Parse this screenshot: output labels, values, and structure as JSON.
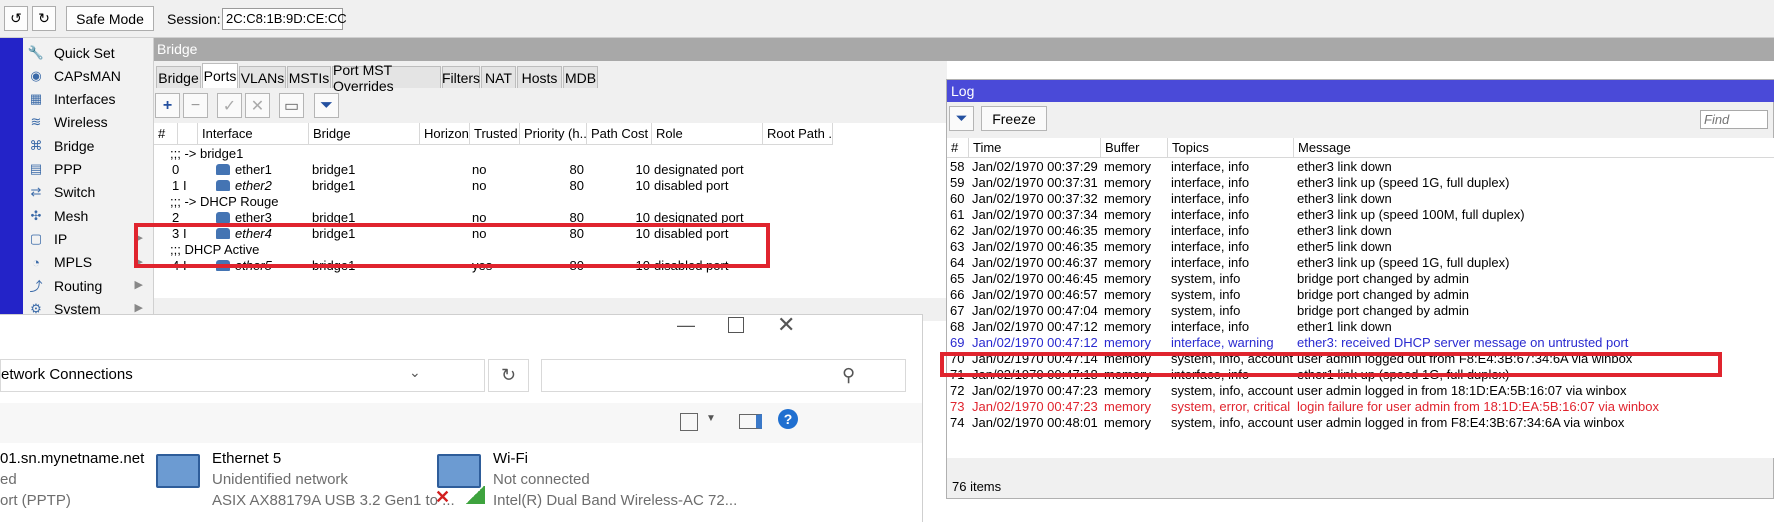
{
  "toolbar": {
    "undo_icon": "↺",
    "redo_icon": "↻",
    "safe_mode_label": "Safe Mode",
    "session_label": "Session:",
    "session_value": "2C:C8:1B:9D:CE:CC"
  },
  "menu": {
    "items": [
      {
        "label": "Quick Set",
        "icon": "wrench-icon"
      },
      {
        "label": "CAPsMAN",
        "icon": "capsman-icon"
      },
      {
        "label": "Interfaces",
        "icon": "interfaces-icon"
      },
      {
        "label": "Wireless",
        "icon": "wireless-icon"
      },
      {
        "label": "Bridge",
        "icon": "bridge-icon"
      },
      {
        "label": "PPP",
        "icon": "ppp-icon"
      },
      {
        "label": "Switch",
        "icon": "switch-icon"
      },
      {
        "label": "Mesh",
        "icon": "mesh-icon"
      },
      {
        "label": "IP",
        "icon": "ip-icon",
        "has_submenu": true
      },
      {
        "label": "MPLS",
        "icon": "mpls-icon",
        "has_submenu": true
      },
      {
        "label": "Routing",
        "icon": "routing-icon",
        "has_submenu": true
      },
      {
        "label": "System",
        "icon": "system-icon",
        "has_submenu": true
      }
    ]
  },
  "bridge": {
    "title": "Bridge",
    "tabs": [
      "Bridge",
      "Ports",
      "VLANs",
      "MSTIs",
      "Port MST Overrides",
      "Filters",
      "NAT",
      "Hosts",
      "MDB"
    ],
    "active_tab": "Ports",
    "actions": {
      "add": "+",
      "remove": "−",
      "enable": "✓",
      "disable": "✕",
      "comment": "▭",
      "filter": "⏷"
    },
    "columns": [
      "#",
      "Interface",
      "Bridge",
      "Horizon",
      "Trusted",
      "Priority (h...",
      "Path Cost",
      "Role",
      "Root Path ..."
    ],
    "rows": [
      {
        "type": "group",
        "text": ";;; -> bridge1"
      },
      {
        "type": "port",
        "num": "0",
        "flag": "",
        "iface": "ether1",
        "bridge": "bridge1",
        "trusted": "no",
        "priority": "80",
        "cost": "10",
        "role": "designated port",
        "italic": false
      },
      {
        "type": "port",
        "num": "1",
        "flag": "I",
        "iface": "ether2",
        "bridge": "bridge1",
        "trusted": "no",
        "priority": "80",
        "cost": "10",
        "role": "disabled port",
        "italic": true
      },
      {
        "type": "group",
        "text": ";;; -> DHCP Rouge"
      },
      {
        "type": "port",
        "num": "2",
        "flag": "",
        "iface": "ether3",
        "bridge": "bridge1",
        "trusted": "no",
        "priority": "80",
        "cost": "10",
        "role": "designated port",
        "italic": false
      },
      {
        "type": "port",
        "num": "3",
        "flag": "I",
        "iface": "ether4",
        "bridge": "bridge1",
        "trusted": "no",
        "priority": "80",
        "cost": "10",
        "role": "disabled port",
        "italic": true
      },
      {
        "type": "group",
        "text": ";;; DHCP Active"
      },
      {
        "type": "port",
        "num": "4",
        "flag": "I",
        "iface": "ether5",
        "bridge": "bridge1",
        "trusted": "yes",
        "priority": "80",
        "cost": "10",
        "role": "disabled port",
        "italic": true
      }
    ]
  },
  "netconn": {
    "address": "etwork Connections",
    "refresh_icon": "↻",
    "search_icon": "⚲",
    "help_icon": "?",
    "items": [
      {
        "name": "01.sn.mynetname.net",
        "status": "ed",
        "device": "ort (PPTP)"
      },
      {
        "name": "Ethernet 5",
        "status": "Unidentified network",
        "device": "ASIX AX88179A USB 3.2 Gen1 to ..."
      },
      {
        "name": "Wi-Fi",
        "status": "Not connected",
        "device": "Intel(R) Dual Band Wireless-AC 72..."
      }
    ]
  },
  "log": {
    "title": "Log",
    "freeze_label": "Freeze",
    "find_placeholder": "Find",
    "columns": [
      "#",
      "Time",
      "Buffer",
      "Topics",
      "Message"
    ],
    "rows": [
      {
        "num": "58",
        "time": "Jan/02/1970 00:37:29",
        "buffer": "memory",
        "topics": "interface, info",
        "message": "ether3 link down",
        "level": "info"
      },
      {
        "num": "59",
        "time": "Jan/02/1970 00:37:31",
        "buffer": "memory",
        "topics": "interface, info",
        "message": "ether3 link up (speed 1G, full duplex)",
        "level": "info"
      },
      {
        "num": "60",
        "time": "Jan/02/1970 00:37:32",
        "buffer": "memory",
        "topics": "interface, info",
        "message": "ether3 link down",
        "level": "info"
      },
      {
        "num": "61",
        "time": "Jan/02/1970 00:37:34",
        "buffer": "memory",
        "topics": "interface, info",
        "message": "ether3 link up (speed 100M, full duplex)",
        "level": "info"
      },
      {
        "num": "62",
        "time": "Jan/02/1970 00:46:35",
        "buffer": "memory",
        "topics": "interface, info",
        "message": "ether3 link down",
        "level": "info"
      },
      {
        "num": "63",
        "time": "Jan/02/1970 00:46:35",
        "buffer": "memory",
        "topics": "interface, info",
        "message": "ether5 link down",
        "level": "info"
      },
      {
        "num": "64",
        "time": "Jan/02/1970 00:46:37",
        "buffer": "memory",
        "topics": "interface, info",
        "message": "ether3 link up (speed 1G, full duplex)",
        "level": "info"
      },
      {
        "num": "65",
        "time": "Jan/02/1970 00:46:45",
        "buffer": "memory",
        "topics": "system, info",
        "message": "bridge port changed by admin",
        "level": "info"
      },
      {
        "num": "66",
        "time": "Jan/02/1970 00:46:57",
        "buffer": "memory",
        "topics": "system, info",
        "message": "bridge port changed by admin",
        "level": "info"
      },
      {
        "num": "67",
        "time": "Jan/02/1970 00:47:04",
        "buffer": "memory",
        "topics": "system, info",
        "message": "bridge port changed by admin",
        "level": "info"
      },
      {
        "num": "68",
        "time": "Jan/02/1970 00:47:12",
        "buffer": "memory",
        "topics": "interface, info",
        "message": "ether1 link down",
        "level": "info"
      },
      {
        "num": "69",
        "time": "Jan/02/1970 00:47:12",
        "buffer": "memory",
        "topics": "interface, warning",
        "message": "ether3: received DHCP server message on untrusted port",
        "level": "warning"
      },
      {
        "num": "70",
        "time": "Jan/02/1970 00:47:14",
        "buffer": "memory",
        "topics": "system, info, account",
        "message": "user admin logged out from F8:E4:3B:67:34:6A via winbox",
        "level": "info"
      },
      {
        "num": "71",
        "time": "Jan/02/1970 00:47:18",
        "buffer": "memory",
        "topics": "interface, info",
        "message": "ether1 link up (speed 1G, full duplex)",
        "level": "info"
      },
      {
        "num": "72",
        "time": "Jan/02/1970 00:47:23",
        "buffer": "memory",
        "topics": "system, info, account",
        "message": "user admin logged in from 18:1D:EA:5B:16:07 via winbox",
        "level": "info"
      },
      {
        "num": "73",
        "time": "Jan/02/1970 00:47:23",
        "buffer": "memory",
        "topics": "system, error, critical",
        "message": "login failure for user admin from 18:1D:EA:5B:16:07 via winbox",
        "level": "critical"
      },
      {
        "num": "74",
        "time": "Jan/02/1970 00:48:01",
        "buffer": "memory",
        "topics": "system, info, account",
        "message": "user admin logged in from F8:E4:3B:67:34:6A via winbox",
        "level": "info"
      }
    ],
    "status": "76 items"
  },
  "colors": {
    "menu_strip": "#2323c8",
    "log_title_bar": "#4a4ad8",
    "highlight_box": "#e0242e",
    "warning_text": "#2a2ad0",
    "critical_text": "#e0242e"
  }
}
